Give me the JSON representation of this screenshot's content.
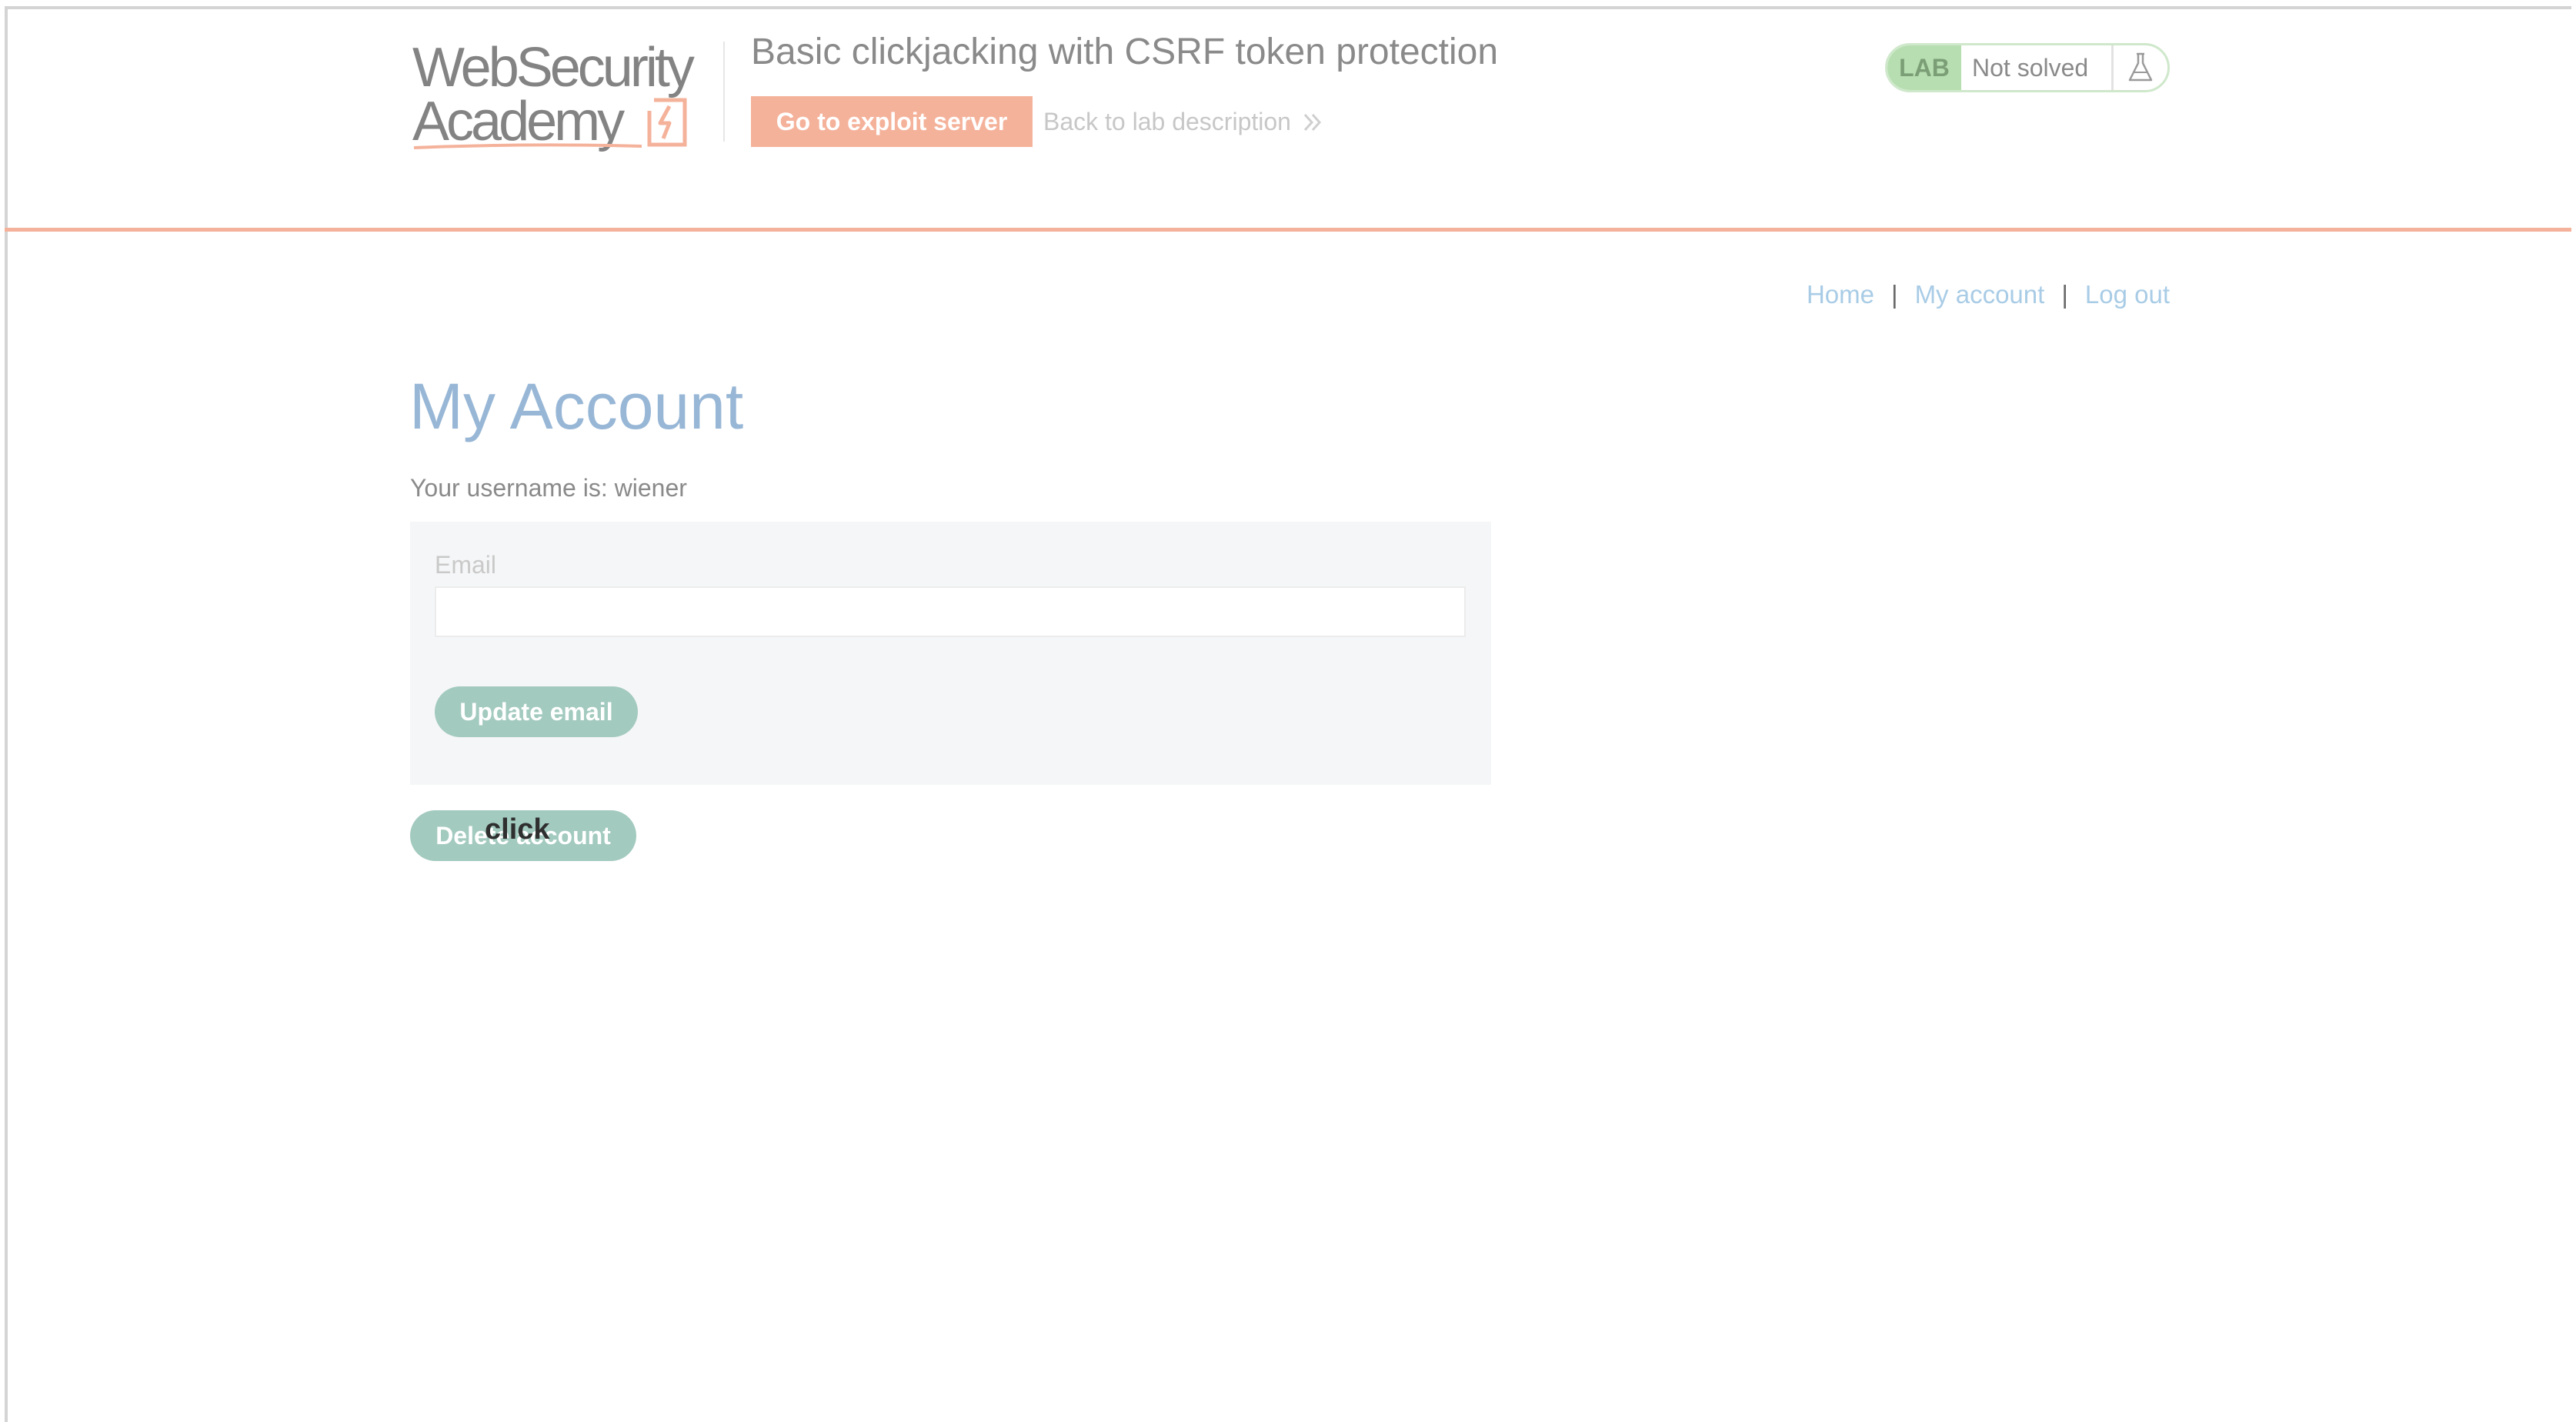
{
  "header": {
    "logo_line1": "WebSecurity",
    "logo_line2": "Academy",
    "lab_title": "Basic clickjacking with CSRF token protection",
    "exploit_button_label": "Go to exploit server",
    "back_link_label": "Back to lab description"
  },
  "status": {
    "badge": "LAB",
    "text": "Not solved",
    "icon": "flask-icon"
  },
  "nav": {
    "items": [
      {
        "label": "Home"
      },
      {
        "label": "My account"
      },
      {
        "label": "Log out"
      }
    ],
    "separator": "|"
  },
  "main": {
    "title": "My Account",
    "username_line": "Your username is: wiener",
    "email_label": "Email",
    "email_value": "",
    "update_button_label": "Update email",
    "delete_button_label": "Delete account",
    "decoy_label": "click"
  },
  "colors": {
    "accent_orange": "#f5b29b",
    "button_green": "#a3cabf",
    "title_blue": "#98b7d6",
    "link_blue": "#a9cce6",
    "lab_green": "#b7deb1"
  }
}
